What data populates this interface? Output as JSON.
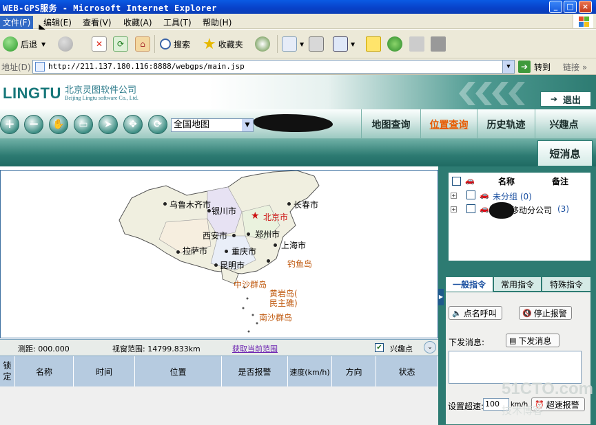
{
  "window": {
    "title": "WEB-GPS服务 - Microsoft Internet Explorer",
    "controls": [
      "_",
      "□",
      "×"
    ]
  },
  "menubar": {
    "items": [
      "文件(F)",
      "编辑(E)",
      "查看(V)",
      "收藏(A)",
      "工具(T)",
      "帮助(H)"
    ]
  },
  "toolbar": {
    "back_label": "后退",
    "search_label": "搜索",
    "favorites_label": "收藏夹"
  },
  "addressbar": {
    "label": "地址(D)",
    "url": "http://211.137.180.116:8888/webgps/main.jsp",
    "go_label": "转到",
    "links_label": "链接"
  },
  "app": {
    "logo": "LINGTU",
    "company_cn": "北京灵图软件公司",
    "company_en": "Beijing Lingtu software Co., Ltd.",
    "logout_label": "退出",
    "map_select_value": "全国地图",
    "nav_tabs": [
      "地图查询",
      "位置查询",
      "历史轨迹",
      "兴趣点"
    ],
    "active_tab": "位置查询",
    "sms_label": "短消息"
  },
  "map": {
    "cities": [
      {
        "name": "乌鲁木齐市",
        "style": "normal"
      },
      {
        "name": "银川市",
        "style": "normal"
      },
      {
        "name": "北京市",
        "style": "red"
      },
      {
        "name": "长春市",
        "style": "normal"
      },
      {
        "name": "西安市",
        "style": "normal"
      },
      {
        "name": "郑州市",
        "style": "normal"
      },
      {
        "name": "拉萨市",
        "style": "normal"
      },
      {
        "name": "重庆市",
        "style": "normal"
      },
      {
        "name": "上海市",
        "style": "normal"
      },
      {
        "name": "昆明市",
        "style": "normal"
      },
      {
        "name": "钓鱼岛",
        "style": "orange"
      },
      {
        "name": "中沙群岛",
        "style": "orange"
      },
      {
        "name": "黄岩岛(",
        "style": "orange"
      },
      {
        "name": "民主礁)",
        "style": "orange"
      },
      {
        "name": "南沙群岛",
        "style": "orange"
      }
    ]
  },
  "status": {
    "distance": "测距: 000.000",
    "view_range": "视窗范围: 14799.833km",
    "get_range_link": "获取当前范围",
    "poi_label": "兴趣点",
    "poi_checked": true
  },
  "table": {
    "headers": [
      "锁定",
      "名称",
      "时间",
      "位置",
      "是否报警",
      "速度(km/h)",
      "方向",
      "状态"
    ]
  },
  "tree": {
    "headers": [
      "名称",
      "备注"
    ],
    "groups": [
      {
        "label": "未分组 (0)"
      },
      {
        "label": "移动分公司",
        "count": "(3)"
      }
    ]
  },
  "commands": {
    "tabs": [
      "一般指令",
      "常用指令",
      "特殊指令"
    ],
    "active_tab": "一般指令",
    "call_label": "点名呼叫",
    "stop_alarm_label": "停止报警",
    "msg_label": "下发消息:",
    "send_msg_label": "下发消息",
    "speed_label": "设置超速:",
    "speed_value": "100",
    "speed_unit": "km/h",
    "overspeed_label": "超速报警"
  },
  "watermark": {
    "line1": "51CTO.com",
    "line2": "技术博客"
  },
  "colors": {
    "theme": "#2d7b72",
    "active_tab": "#e85a00",
    "link": "#6a1fb0"
  }
}
